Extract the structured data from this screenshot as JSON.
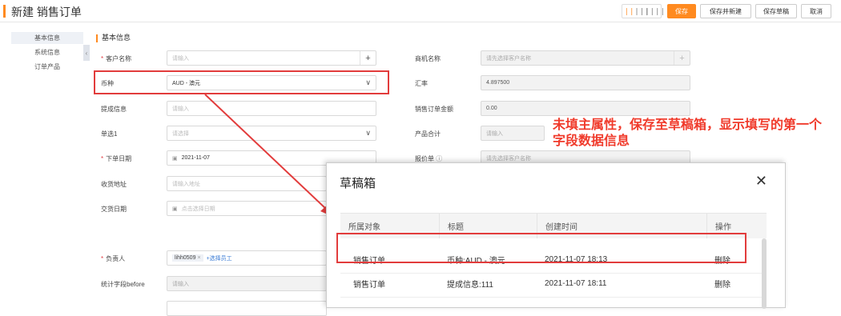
{
  "header": {
    "title": "新建 销售订单",
    "buttons": {
      "save": "保存",
      "save_new": "保存并新建",
      "save_draft": "保存草稿",
      "cancel": "取消"
    }
  },
  "sidebar": {
    "items": [
      "基本信息",
      "系统信息",
      "订单产品"
    ],
    "collapse_glyph": "‹"
  },
  "section_title": "基本信息",
  "left_form": {
    "customer": {
      "label": "客户名称",
      "placeholder": "请输入"
    },
    "currency": {
      "label": "币种",
      "value": "AUD - 澳元"
    },
    "mention": {
      "label": "提成信息",
      "placeholder": "请输入"
    },
    "single": {
      "label": "单选1",
      "placeholder": "请选择"
    },
    "order_date": {
      "label": "下单日期",
      "value": "2021-11-07"
    },
    "address": {
      "label": "收货地址",
      "placeholder": "请输入地址"
    },
    "delivery": {
      "label": "交货日期",
      "placeholder": "点击选择日期"
    },
    "owner": {
      "label": "负责人",
      "tag": "lihh0509",
      "link": "+选择员工"
    },
    "stat_before": {
      "label": "统计字段before",
      "placeholder": "请输入"
    }
  },
  "right_form": {
    "opportunity": {
      "label": "商机名称",
      "placeholder": "请先选择客户名称"
    },
    "rate": {
      "label": "汇率",
      "value": "4.897500"
    },
    "amount": {
      "label": "销售订单金额",
      "value": "0.00"
    },
    "product_total": {
      "label": "产品合计",
      "placeholder": "请输入"
    },
    "quote": {
      "label": "报价单",
      "placeholder": "请先选择客户名称"
    }
  },
  "annotation": "未填主属性，保存至草稿箱，显示填写的第一个字段数据信息",
  "draft_dialog": {
    "title": "草稿箱",
    "columns": [
      "所属对象",
      "标题",
      "创建时间",
      "操作"
    ],
    "rows": [
      {
        "object": "销售订单",
        "title": "币种:AUD - 澳元",
        "created": "2021-11-07 18:13",
        "action": "删除"
      },
      {
        "object": "销售订单",
        "title": "提成信息:111",
        "created": "2021-11-07 18:11",
        "action": "删除"
      }
    ]
  },
  "colors": {
    "accent": "#ff8a1f",
    "highlight_red": "#e23c3c",
    "annotation_red": "#f03a2b"
  }
}
